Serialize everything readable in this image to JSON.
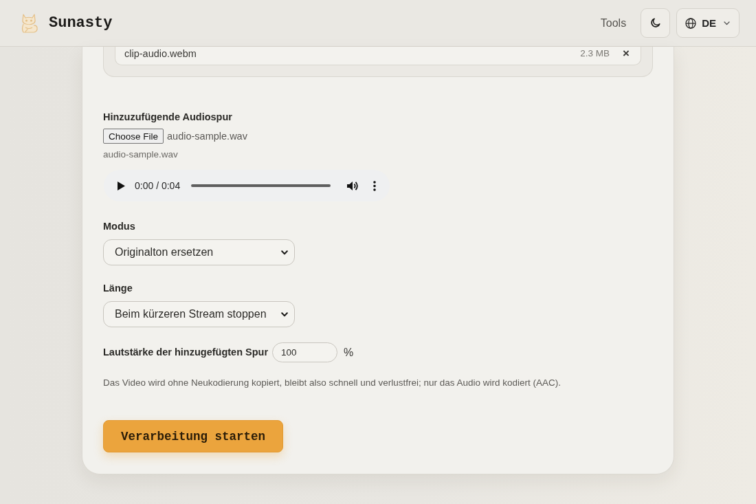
{
  "header": {
    "brand": "Sunasty",
    "nav": [
      {
        "label": "Tools"
      }
    ],
    "language": {
      "code": "DE"
    }
  },
  "upload": {
    "files": [
      {
        "name": "clip-audio.webm",
        "size": "2.3 MB",
        "remove": "×"
      }
    ]
  },
  "audio_track": {
    "label": "Hinzuzufügende Audiospur",
    "file_button": "Choose File",
    "chosen_file": "audio-sample.wav",
    "file_caption": "audio-sample.wav",
    "player": {
      "time": "0:00 / 0:04"
    }
  },
  "options": [
    {
      "kind": "select",
      "label": "Modus",
      "value": "Originalton ersetzen"
    },
    {
      "kind": "select",
      "label": "Länge",
      "value": "Beim kürzeren Stream stoppen"
    },
    {
      "kind": "number",
      "label": "Lautstärke der hinzugefügten Spur",
      "value": "100",
      "unit": "%"
    }
  ],
  "note": "Das Video wird ohne Neukodierung kopiert, bleibt also schnell und verlustfrei; nur das Audio wird kodiert (AAC).",
  "submit": "Verarbeitung starten"
}
